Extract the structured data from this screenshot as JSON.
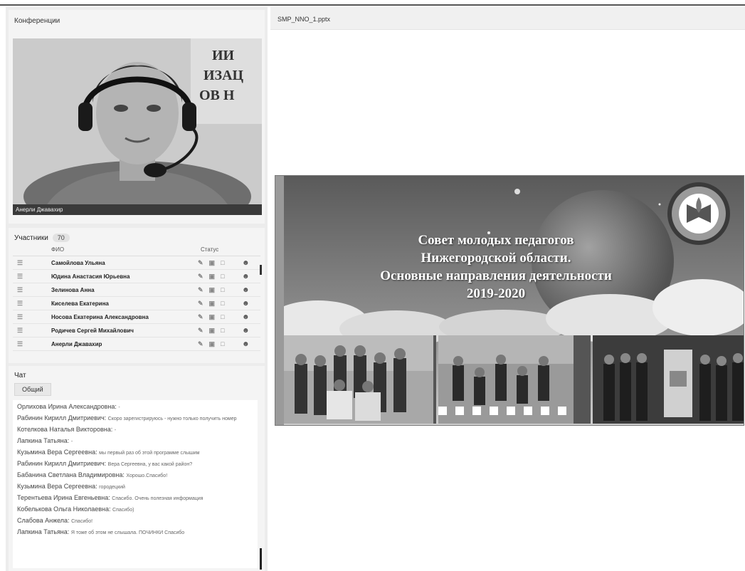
{
  "left": {
    "conference_title": "Конференции",
    "video_name": "Анерли Джавахир",
    "participants": {
      "title": "Участники",
      "count": "70",
      "col_name": "ФИО",
      "col_status": "Статус",
      "rows": [
        {
          "name": "Самойлова Ульяна"
        },
        {
          "name": "Юдина Анастасия Юрьевна"
        },
        {
          "name": "Зелинова Анна"
        },
        {
          "name": "Киселева Екатерина"
        },
        {
          "name": "Носова Екатерина Александровна"
        },
        {
          "name": "Родичев Сергей Михайлович"
        },
        {
          "name": "Анерли Джавахир"
        }
      ]
    },
    "chat": {
      "title": "Чат",
      "tab": "Общий",
      "messages": [
        {
          "who": "Орлихова Ирина Александровна:",
          "text": "-"
        },
        {
          "who": "Рабинин Кирилл Дмитриевич:",
          "text": "Скоро зарегистрируюсь - нужно только получить номер"
        },
        {
          "who": "Котелкова Наталья Викторовна:",
          "text": "-"
        },
        {
          "who": "Лапкина Татьяна:",
          "text": "-"
        },
        {
          "who": "Кузьмина Вера Сергеевна:",
          "text": "мы первый раз об этой программе слышим"
        },
        {
          "who": "Рабинин Кирилл Дмитриевич:",
          "text": "Вера Сергеевна, у вас какой район?"
        },
        {
          "who": "Бабанина Светлана Владимировна:",
          "text": "Хорошо.Спасибо!"
        },
        {
          "who": "Кузьмина Вера Сергеевна:",
          "text": "городецкий"
        },
        {
          "who": "Терентьева Ирина Евгеньевна:",
          "text": "Спасибо. Очень полезная информация"
        },
        {
          "who": "Кобелькова Ольга Николаевна:",
          "text": "Спасибо)"
        },
        {
          "who": "Слабова Анжела:",
          "text": "Спасибо!"
        },
        {
          "who": "Лапкина Татьяна:",
          "text": "Я тоже об этом не слышала. ПОЧИНКИ Спасибо"
        }
      ]
    }
  },
  "right": {
    "file_name": "SMP_NNO_1.pptx",
    "slide": {
      "line1": "Совет молодых педагогов",
      "line2": "Нижегородской области.",
      "line3": "Основные направления деятельности",
      "line4": "2019-2020"
    }
  },
  "icons": {
    "mic": "microphone-icon",
    "cam": "camera-icon",
    "screen": "screen-icon",
    "person": "person-icon"
  }
}
